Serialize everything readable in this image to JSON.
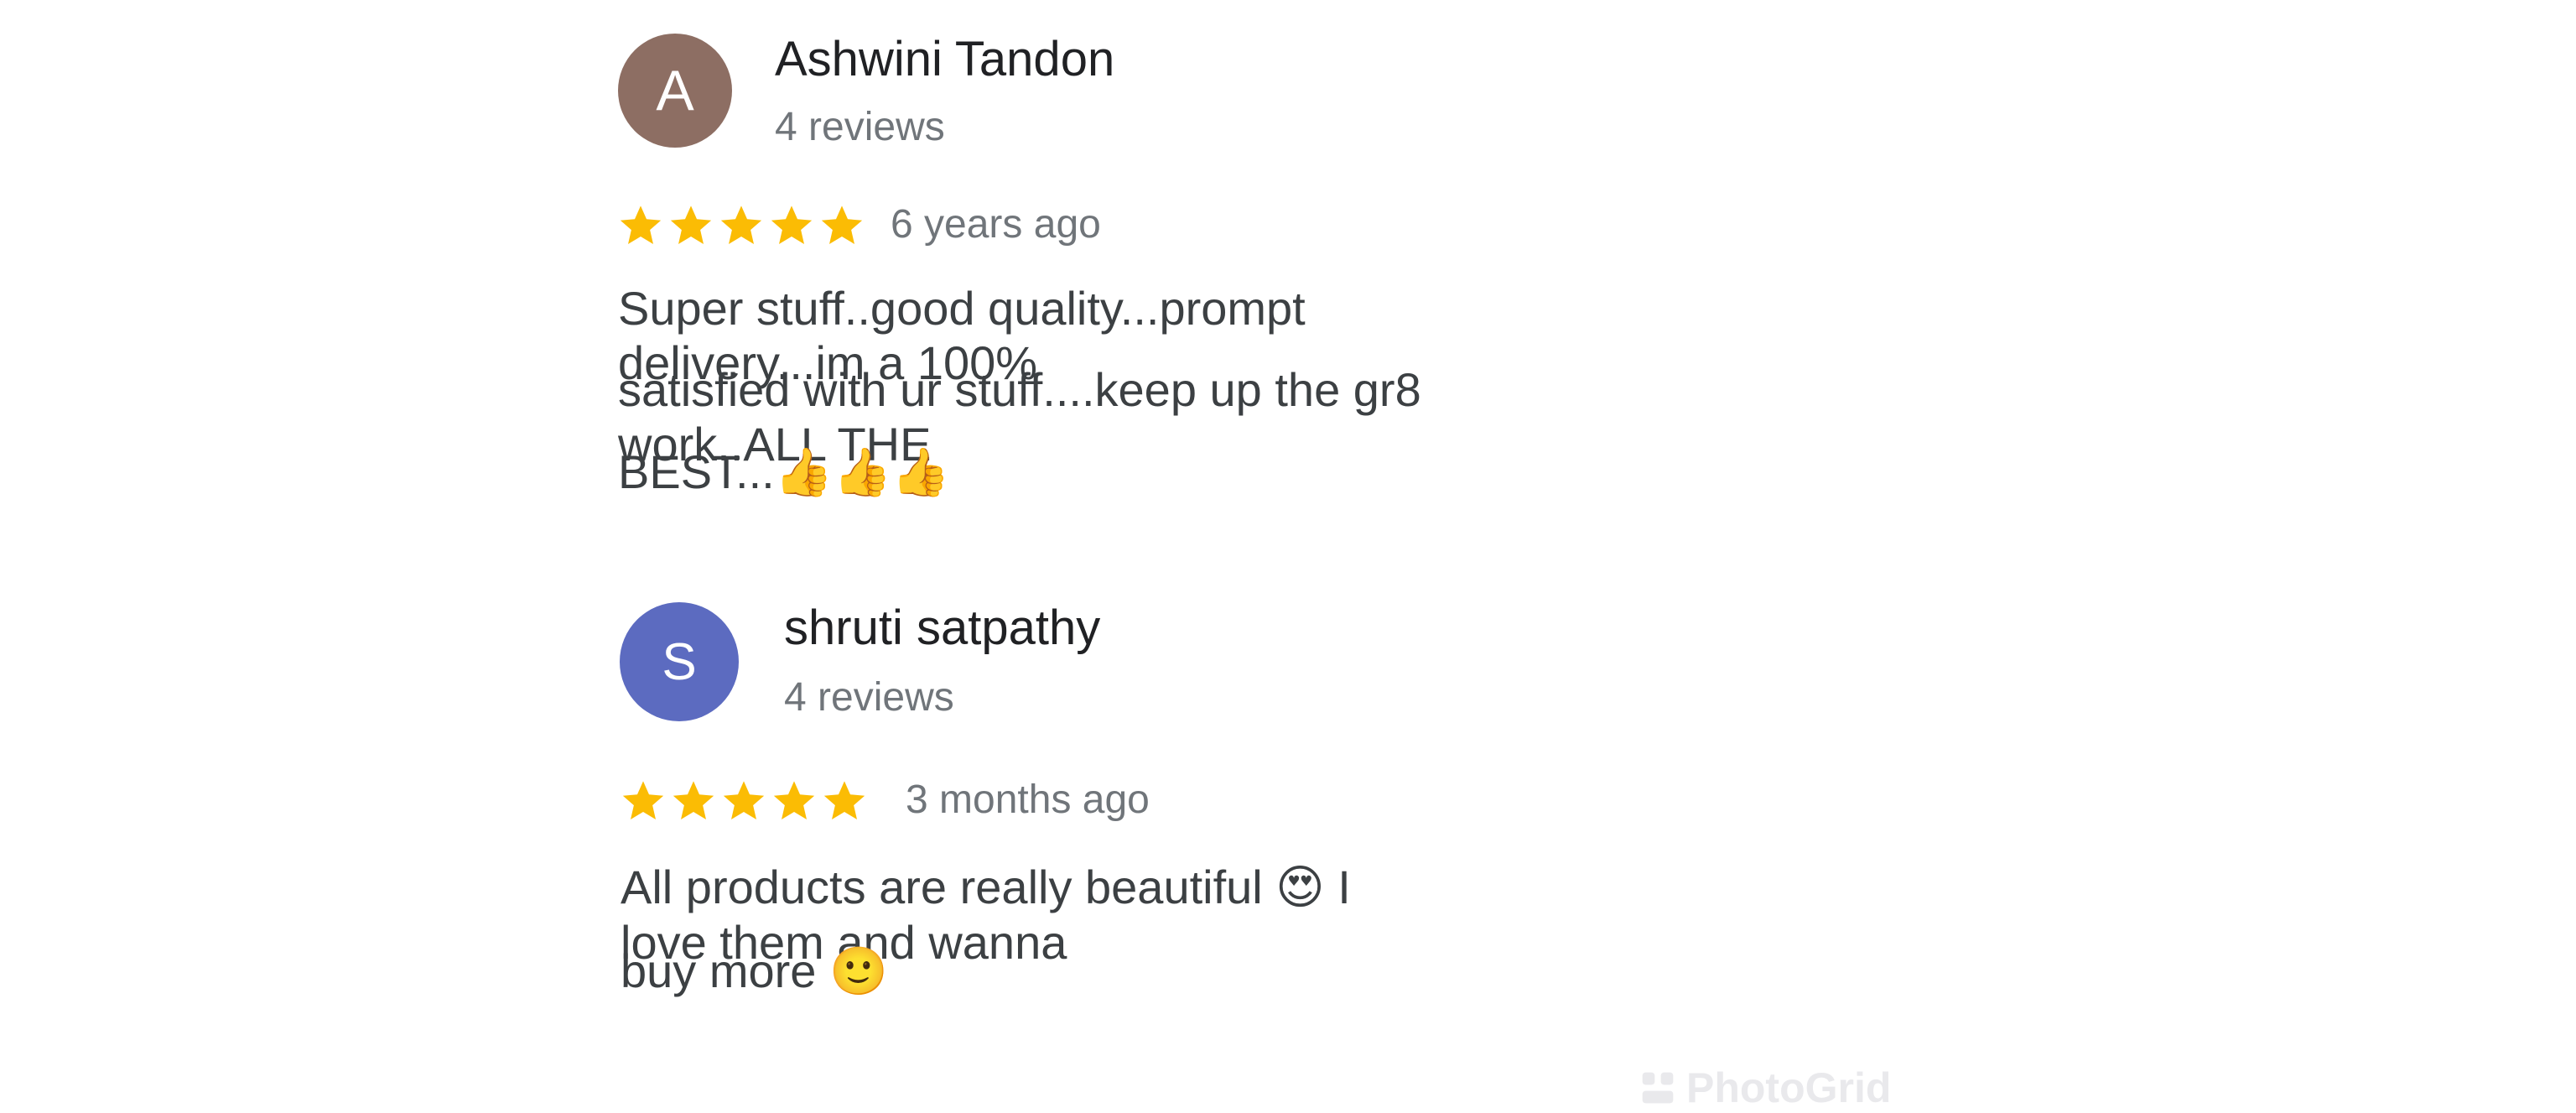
{
  "reviews": [
    {
      "avatar_letter": "A",
      "avatar_color": "#8d6e63",
      "author": "Ashwini Tandon",
      "reviews_count": "4 reviews",
      "rating": 5,
      "time": "6 years ago",
      "text_lines": [
        "Super stuff..good quality...prompt delivery...im a 100%",
        "satisfied with ur stuff....keep up the gr8 work..ALL THE",
        "BEST...👍👍👍"
      ]
    },
    {
      "avatar_letter": "S",
      "avatar_color": "#5c6bc0",
      "author": "shruti satpathy",
      "reviews_count": "4 reviews",
      "rating": 5,
      "time": "3 months ago",
      "text_lines": [
        "All products are really beautiful 😍 I love them and wanna",
        "buy more 🙂"
      ]
    }
  ],
  "star_color": "#fbbc04",
  "watermark": "PhotoGrid"
}
